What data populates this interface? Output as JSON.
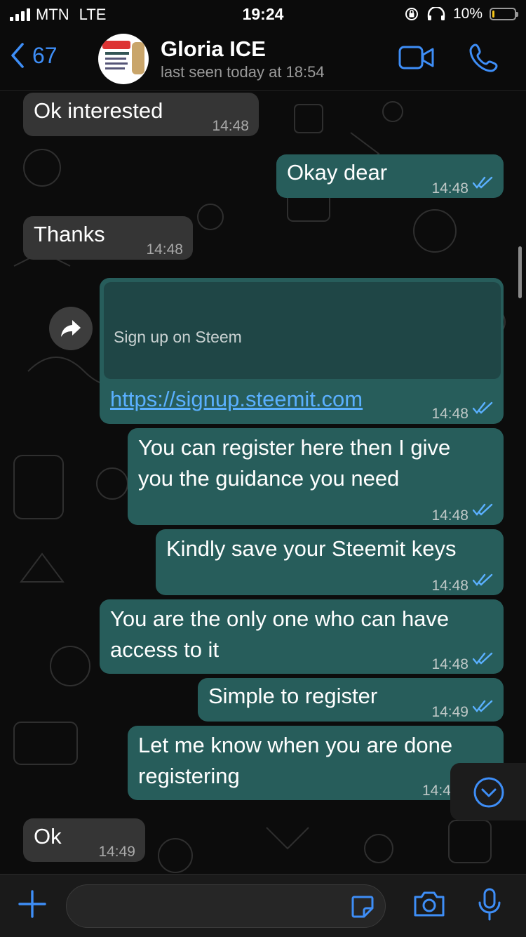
{
  "status_bar": {
    "carrier": "MTN",
    "network": "LTE",
    "time": "19:24",
    "battery": "10%",
    "battery_level": 0.1
  },
  "header": {
    "back_count": "67",
    "contact_name": "Gloria ICE",
    "last_seen": "last seen today at 18:54",
    "avatar_text": "HYE DEPA"
  },
  "messages": [
    {
      "dir": "in",
      "text": "Ok interested",
      "time": "14:48"
    },
    {
      "dir": "out",
      "text": "Okay dear",
      "time": "14:48",
      "status": "read"
    },
    {
      "dir": "in",
      "text": "Thanks",
      "time": "14:48"
    },
    {
      "dir": "out",
      "type": "link",
      "link_title": "Sign up on Steem",
      "url": "https://signup.steemit.com",
      "time": "14:48",
      "status": "read"
    },
    {
      "dir": "out",
      "lines": [
        "You can register here then I give",
        "you the guidance you need"
      ],
      "time": "14:48",
      "status": "read"
    },
    {
      "dir": "out",
      "text": "Kindly save your Steemit keys",
      "time": "14:48",
      "status": "read"
    },
    {
      "dir": "out",
      "lines": [
        "You are the only one who can have",
        "access to it"
      ],
      "time": "14:48",
      "status": "read"
    },
    {
      "dir": "out",
      "text": "Simple to register",
      "time": "14:49",
      "status": "read"
    },
    {
      "dir": "out",
      "lines": [
        "Let me know when you are done",
        "registering"
      ],
      "time": "14:4",
      "status": "read"
    },
    {
      "dir": "in",
      "text": "Ok",
      "time": "14:49"
    }
  ],
  "input": {
    "placeholder": ""
  },
  "colors": {
    "accent": "#3e8ef7",
    "outgoing_bubble": "#275d5b",
    "incoming_bubble": "#353535",
    "read_ticks": "#5ab0ff",
    "link": "#5ab0ff"
  },
  "icons": [
    "back-chevron-icon",
    "video-call-icon",
    "voice-call-icon",
    "forward-icon",
    "read-ticks-icon",
    "scroll-down-icon",
    "plus-icon",
    "sticker-icon",
    "camera-icon",
    "microphone-icon"
  ]
}
